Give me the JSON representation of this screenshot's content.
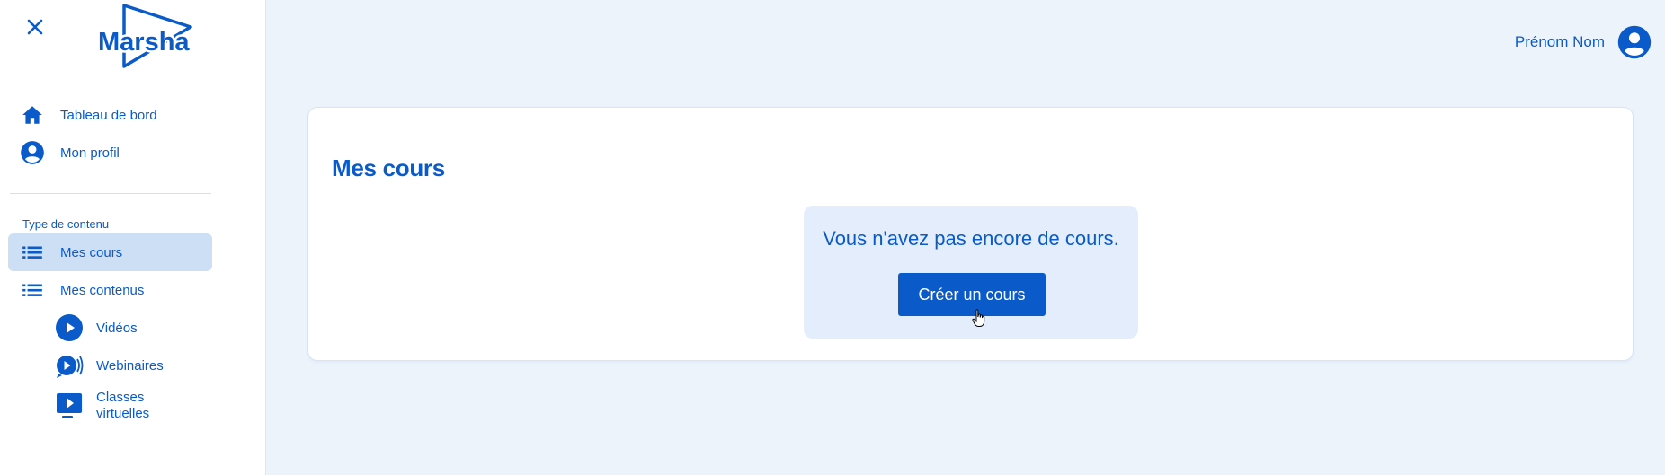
{
  "colors": {
    "primary": "#0a5bc9",
    "background": "#edf3fb",
    "active_item": "#cddff5",
    "empty_box": "#e3edfb"
  },
  "sidebar": {
    "close_icon": "close-icon",
    "logo_text": "Marsha",
    "items": [
      {
        "label": "Tableau de bord",
        "icon": "home-icon"
      },
      {
        "label": "Mon profil",
        "icon": "account-circle-icon"
      }
    ],
    "section_title": "Type de contenu",
    "content_items": [
      {
        "label": "Mes cours",
        "icon": "list-icon",
        "active": true
      },
      {
        "label": "Mes contenus",
        "icon": "list-icon",
        "active": false
      }
    ],
    "sub_items": [
      {
        "label": "Vidéos",
        "icon": "play-circle-icon"
      },
      {
        "label": "Webinaires",
        "icon": "webinar-icon"
      },
      {
        "label_line1": "Classes",
        "label_line2": "virtuelles",
        "icon": "classroom-icon"
      }
    ]
  },
  "header": {
    "user_name": "Prénom Nom",
    "avatar_icon": "avatar-icon"
  },
  "main": {
    "title": "Mes cours",
    "empty_message": "Vous n'avez pas encore de cours.",
    "create_button": "Créer un cours"
  }
}
